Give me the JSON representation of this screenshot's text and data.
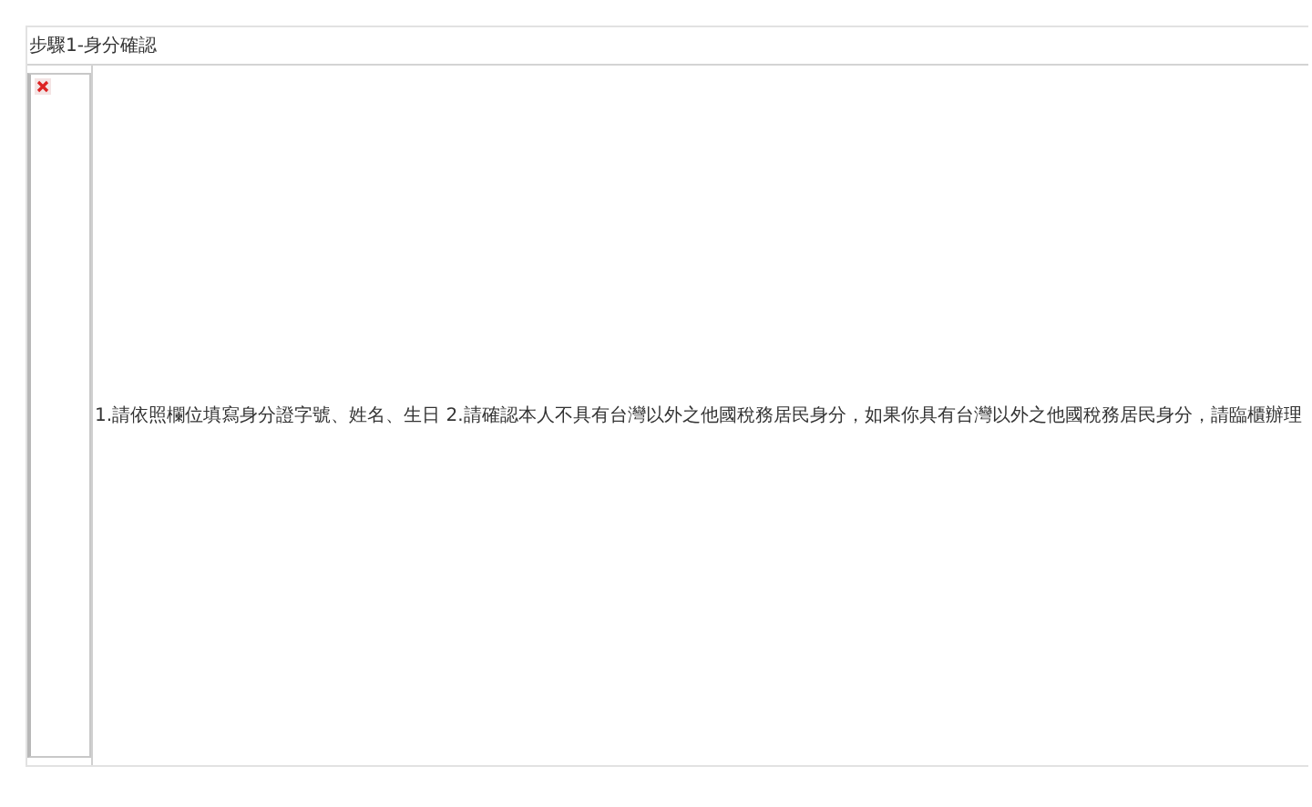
{
  "panel": {
    "title": "步驟1-身分確認",
    "message": "1.請依照欄位填寫身分證字號、姓名、生日 2.請確認本人不具有台灣以外之他國稅務居民身分，如果你具有台灣以外之他國稅務居民身分，請臨櫃辦理"
  }
}
